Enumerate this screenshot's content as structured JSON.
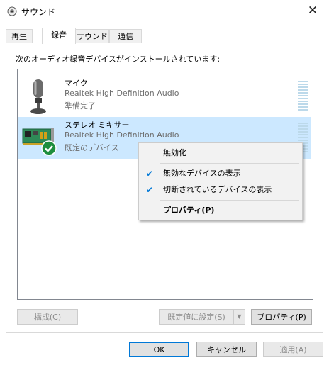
{
  "window": {
    "title": "サウンド",
    "close_glyph": "✕"
  },
  "tabs": [
    {
      "label": "再生",
      "active": false
    },
    {
      "label": "録音",
      "active": true
    },
    {
      "label": "サウンド",
      "active": false
    },
    {
      "label": "通信",
      "active": false
    }
  ],
  "instruction": "次のオーディオ録音デバイスがインストールされています:",
  "devices": [
    {
      "name": "マイク",
      "driver": "Realtek High Definition Audio",
      "status": "準備完了",
      "icon": "microphone-icon",
      "selected": false
    },
    {
      "name": "ステレオ ミキサー",
      "driver": "Realtek High Definition Audio",
      "status": "既定のデバイス",
      "icon": "sound-card-icon",
      "selected": true
    }
  ],
  "context_menu": {
    "items": [
      {
        "label": "無効化",
        "checked": false,
        "bold": false
      },
      {
        "label": "無効なデバイスの表示",
        "checked": true,
        "bold": false
      },
      {
        "label": "切断されているデバイスの表示",
        "checked": true,
        "bold": false
      },
      {
        "label": "プロパティ(P)",
        "checked": false,
        "bold": true
      }
    ]
  },
  "buttons": {
    "configure": "構成(C)",
    "set_default": "既定値に設定(S)",
    "properties": "プロパティ(P)",
    "ok": "OK",
    "cancel": "キャンセル",
    "apply": "適用(A)"
  },
  "colors": {
    "accent": "#0078d7",
    "selection": "#cce8ff",
    "default_badge": "#1e8e3e"
  }
}
